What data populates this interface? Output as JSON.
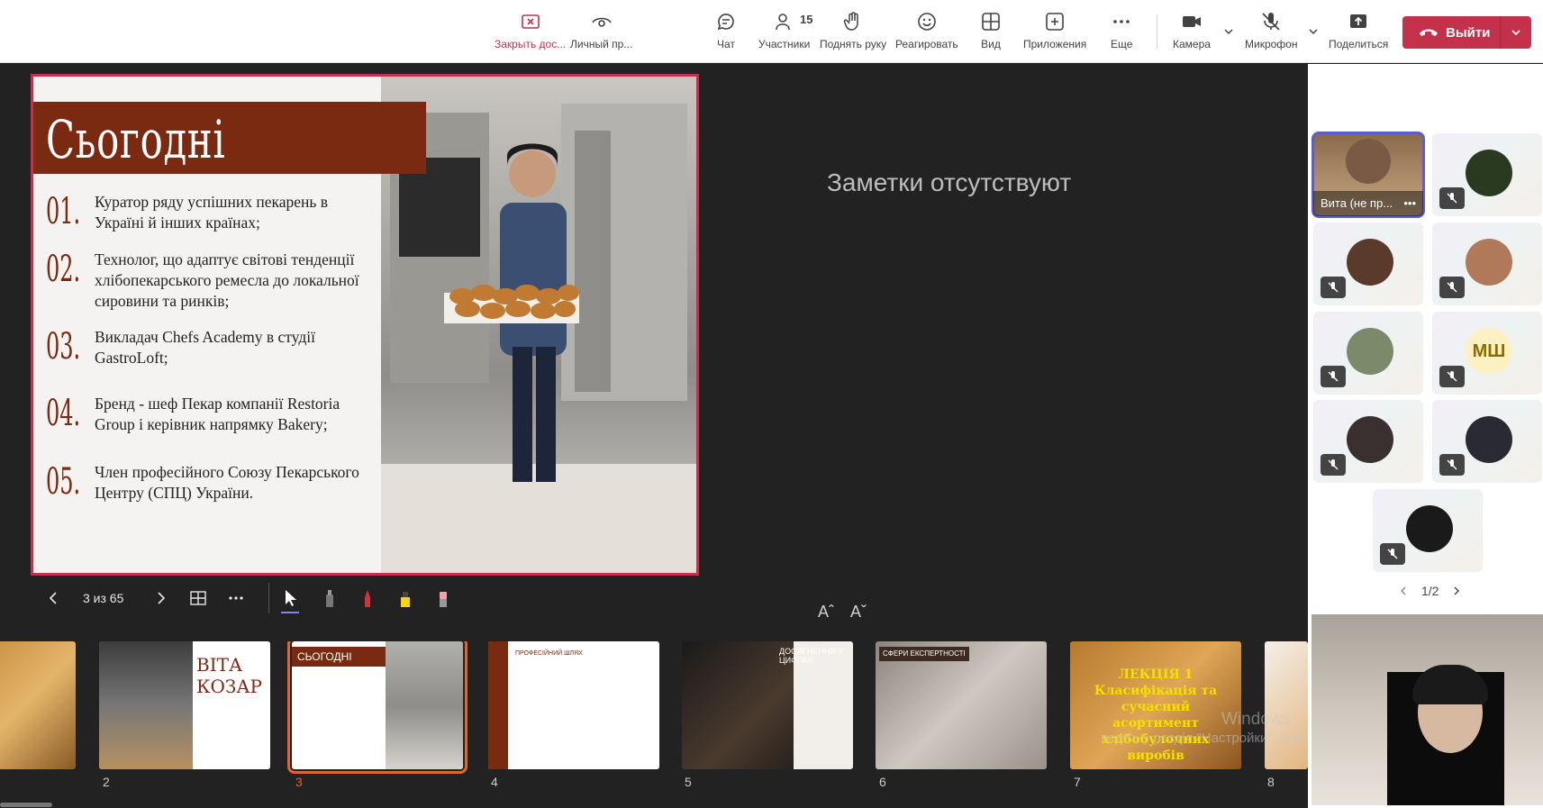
{
  "toolbar": {
    "stop_sharing": "Закрыть дос...",
    "personal": "Личный пр...",
    "chat": "Чат",
    "participants": "Участники",
    "participants_count": "15",
    "raise_hand": "Поднять руку",
    "react": "Реагировать",
    "view": "Вид",
    "apps": "Приложения",
    "more": "Еще",
    "camera": "Камера",
    "mic": "Микрофон",
    "share": "Поделиться",
    "leave": "Выйти"
  },
  "slide": {
    "title": "Сьогодні",
    "items": [
      {
        "num": "01.",
        "text": "Куратор ряду успішних пекарень в Україні й інших країнах;"
      },
      {
        "num": "02.",
        "text": "Технолог, що адаптує світові тенденції хлібопекарського ремесла до локальної сировини та ринків;"
      },
      {
        "num": "03.",
        "text": "Викладач Chefs Academy в студії GastroLoft;"
      },
      {
        "num": "04.",
        "text": "Бренд - шеф Пекар компанії Restoria Group і керівник напрямку Bakery;"
      },
      {
        "num": "05.",
        "text": "Член професійного Союзу Пекарського Центру (СПЦ) України."
      }
    ]
  },
  "notes": "Заметки отсутствуют",
  "font_controls": {
    "increase": "Aˆ",
    "decrease": "Aˇ"
  },
  "slide_nav": {
    "counter": "3 из 65"
  },
  "thumbnails": [
    {
      "num": "2",
      "caption": "ВІТА КОЗАР"
    },
    {
      "num": "3",
      "caption": "СЬОГОДНІ"
    },
    {
      "num": "4",
      "caption": "ПРОФЕСІЙНИЙ ШЛЯХ"
    },
    {
      "num": "5",
      "caption": "ДОСЯГНЕННЯ У ЦИФРАХ"
    },
    {
      "num": "6",
      "caption": "СФЕРИ ЕКСПЕРТНОСТІ"
    },
    {
      "num": "7",
      "caption": "ЛЕКЦІЯ 1 Класифікація та сучасний асортимент хлібобулочних виробів"
    },
    {
      "num": "8",
      "caption": ""
    }
  ],
  "gallery": {
    "speaker_name": "Вита (не пр...",
    "initials": "МШ",
    "pager": "1/2"
  },
  "watermark": {
    "line1": "Windows",
    "line2": "ведіть у розділ \"Настройки\", щоб активувати Windows."
  },
  "colors": {
    "accent": "#c4314b",
    "slide_brown": "#7a2a10",
    "active_thumb": "#e0662f",
    "brand": "#5b5fc7"
  }
}
